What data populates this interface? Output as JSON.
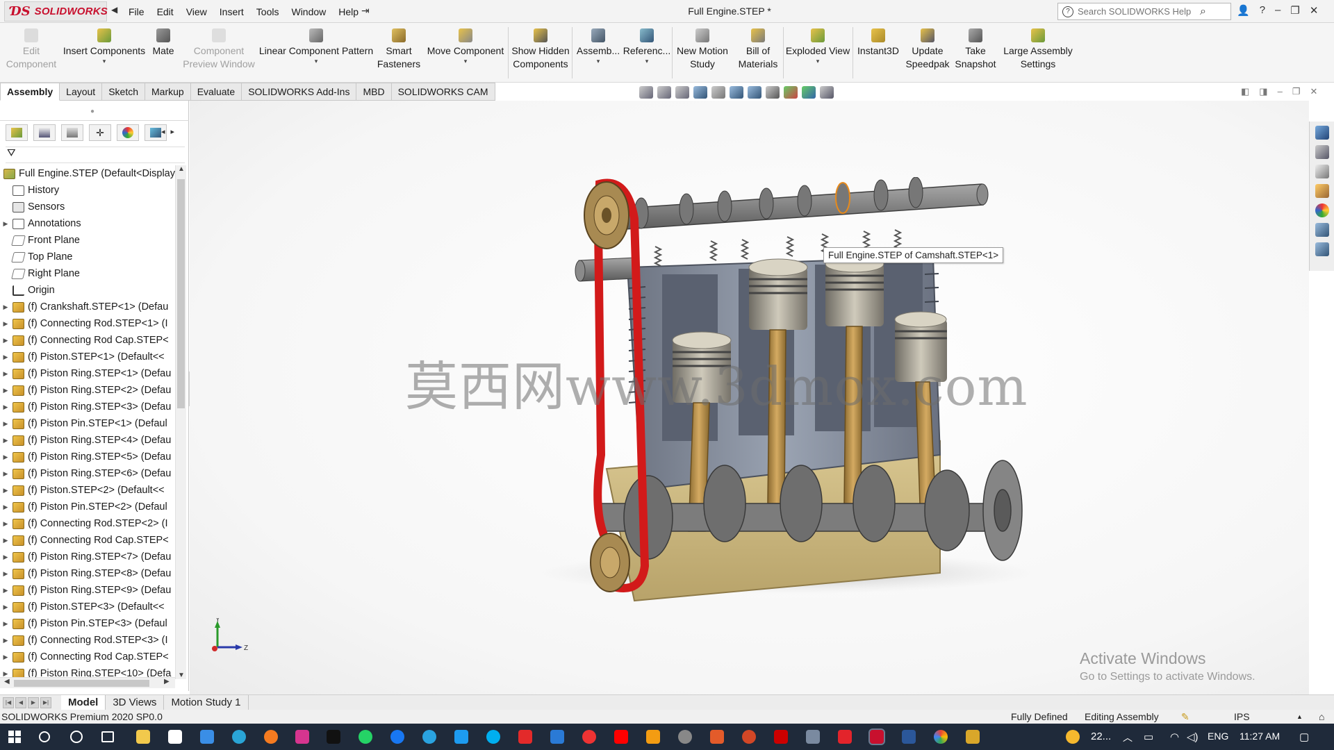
{
  "app": {
    "brand": "SOLIDWORKS",
    "document_title": "Full Engine.STEP *",
    "search_placeholder": "Search SOLIDWORKS Help"
  },
  "menu": [
    "File",
    "Edit",
    "View",
    "Insert",
    "Tools",
    "Window",
    "Help"
  ],
  "toolbar": {
    "edit_component": "Edit\nComponent",
    "insert_components": "Insert Components",
    "mate": "Mate",
    "component_preview": "Component\nPreview Window",
    "linear_pattern": "Linear Component Pattern",
    "smart_fasteners": "Smart\nFasteners",
    "move_component": "Move Component",
    "show_hidden": "Show Hidden\nComponents",
    "assembly": "Assemb...",
    "reference": "Referenc...",
    "new_motion": "New Motion\nStudy",
    "bom": "Bill of\nMaterials",
    "exploded": "Exploded View",
    "instant3d": "Instant3D",
    "speedpak": "Update\nSpeedpak",
    "snapshot": "Take\nSnapshot",
    "large_assembly": "Large Assembly\nSettings"
  },
  "tabs": [
    "Assembly",
    "Layout",
    "Sketch",
    "Markup",
    "Evaluate",
    "SOLIDWORKS Add-Ins",
    "MBD",
    "SOLIDWORKS CAM"
  ],
  "tree": {
    "root": "Full Engine.STEP  (Default<Display",
    "fixed": [
      "History",
      "Sensors",
      "Annotations",
      "Front Plane",
      "Top Plane",
      "Right Plane",
      "Origin"
    ],
    "parts": [
      "(f) Crankshaft.STEP<1> (Defau",
      "(f) Connecting Rod.STEP<1> (I",
      "(f) Connecting Rod Cap.STEP<",
      "(f) Piston.STEP<1> (Default<<",
      "(f) Piston Ring.STEP<1> (Defau",
      "(f) Piston Ring.STEP<2> (Defau",
      "(f) Piston Ring.STEP<3> (Defau",
      "(f) Piston Pin.STEP<1> (Defaul",
      "(f) Piston Ring.STEP<4> (Defau",
      "(f) Piston Ring.STEP<5> (Defau",
      "(f) Piston Ring.STEP<6> (Defau",
      "(f) Piston.STEP<2> (Default<<",
      "(f) Piston Pin.STEP<2> (Defaul",
      "(f) Connecting Rod.STEP<2> (I",
      "(f) Connecting Rod Cap.STEP<",
      "(f) Piston Ring.STEP<7> (Defau",
      "(f) Piston Ring.STEP<8> (Defau",
      "(f) Piston Ring.STEP<9> (Defau",
      "(f) Piston.STEP<3> (Default<<",
      "(f) Piston Pin.STEP<3> (Defaul",
      "(f) Connecting Rod.STEP<3> (I",
      "(f) Connecting Rod Cap.STEP<",
      "(f) Piston Ring.STEP<10> (Defa"
    ]
  },
  "viewport": {
    "tooltip": "Full Engine.STEP of Camshaft.STEP<1>",
    "watermark": "莫西网www.3dmox.com",
    "activate_title": "Activate Windows",
    "activate_sub": "Go to Settings to activate Windows.",
    "triad_y": "Y",
    "triad_z": "Z"
  },
  "bottom_tabs": [
    "Model",
    "3D Views",
    "Motion Study 1"
  ],
  "status": {
    "product": "SOLIDWORKS Premium 2020 SP0.0",
    "defined": "Fully Defined",
    "mode": "Editing Assembly",
    "units": "IPS"
  },
  "taskbar": {
    "weather": "22...",
    "lang": "ENG",
    "time": "11:27 AM"
  },
  "colors": {
    "brand_red": "#c8102e",
    "taskbar": "#1f2a3a",
    "block_steel": "#7d8592",
    "rod_bronze": "#b88a4a",
    "belt_red": "#d21a1a"
  }
}
